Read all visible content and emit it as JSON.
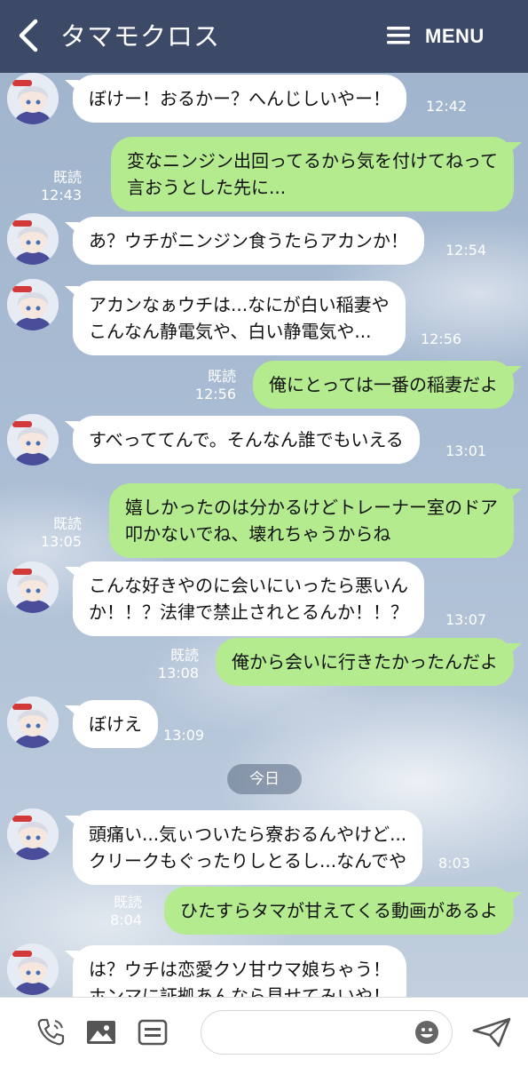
{
  "header": {
    "title": "タマモクロス",
    "menu_label": "MENU"
  },
  "messages": [
    {
      "dir": "in",
      "lines": [
        "ぼけー！おるかー？へんじしいやー！"
      ],
      "time": "12:42"
    },
    {
      "dir": "out",
      "lines": [
        "変なニンジン出回ってるから気を付けてねって",
        "言おうとした先に..."
      ],
      "read": "既読",
      "time": "12:43"
    },
    {
      "dir": "in",
      "lines": [
        "あ？ウチがニンジン食うたらアカンか！"
      ],
      "time": "12:54"
    },
    {
      "dir": "in",
      "lines": [
        "アカンなぁウチは...なにが白い稲妻や",
        "こんなん静電気や、白い静電気や..."
      ],
      "time": "12:56"
    },
    {
      "dir": "out",
      "lines": [
        "俺にとっては一番の稲妻だよ"
      ],
      "read": "既読",
      "time": "12:56"
    },
    {
      "dir": "in",
      "lines": [
        "すべっててんで。そんなん誰でもいえる"
      ],
      "time": "13:01"
    },
    {
      "dir": "out",
      "lines": [
        "嬉しかったのは分かるけどトレーナー室のドア",
        "叩かないでね、壊れちゃうからね"
      ],
      "read": "既読",
      "time": "13:05"
    },
    {
      "dir": "in",
      "lines": [
        "こんな好きやのに会いにいったら悪いん",
        "か！！？法律で禁止されとるんか！！？"
      ],
      "time": "13:07"
    },
    {
      "dir": "out",
      "lines": [
        "俺から会いに行きたかったんだよ"
      ],
      "read": "既読",
      "time": "13:08"
    },
    {
      "dir": "in",
      "lines": [
        "ぼけえ"
      ],
      "time": "13:09"
    },
    {
      "dir": "in",
      "lines": [
        "頭痛い...気ぃついたら寮おるんやけど...",
        "クリークもぐったりしとるし...なんでや"
      ],
      "time": "8:03"
    },
    {
      "dir": "out",
      "lines": [
        "ひたすらタマが甘えてくる動画があるよ"
      ],
      "read": "既読",
      "time": "8:04"
    },
    {
      "dir": "in",
      "lines": [
        "は？ウチは恋愛クソ甘ウマ娘ちゃう！",
        "ホンマに証拠あんなら見せてみいや！"
      ],
      "time": ""
    }
  ],
  "date_separator": "今日",
  "footer": {
    "input_value": "",
    "icons": [
      "phone-icon",
      "image-icon",
      "keep-icon",
      "emoji-icon",
      "send-icon"
    ]
  },
  "colors": {
    "header_bg": "#3c4a67",
    "outgoing_bubble": "#b4eb8f",
    "incoming_bubble": "#ffffff"
  }
}
